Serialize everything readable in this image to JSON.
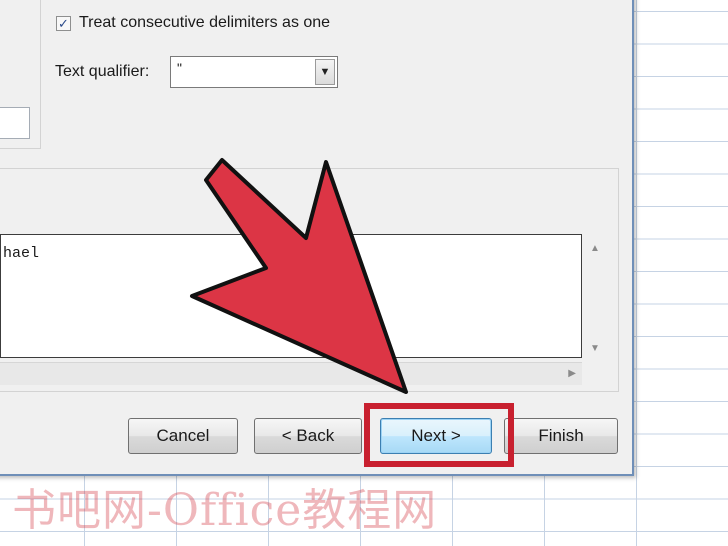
{
  "dialog": {
    "options": {
      "consecutive_delimiters": {
        "label": "Treat consecutive delimiters as one",
        "checked": true,
        "check_glyph": "✓"
      },
      "text_qualifier": {
        "label": "Text qualifier:",
        "value": "\"",
        "arrow_glyph": "▼"
      }
    },
    "preview": {
      "line": "hael",
      "scroll_up_glyph": "▲",
      "scroll_down_glyph": "▼",
      "scroll_right_glyph": "▶"
    },
    "buttons": {
      "cancel": "Cancel",
      "back": "< Back",
      "next": "Next >",
      "finish": "Finish"
    }
  },
  "annotation": {
    "arrow_color": "#dc3545",
    "highlight_color": "#c8202f"
  },
  "watermark": "书吧网-Office教程网"
}
